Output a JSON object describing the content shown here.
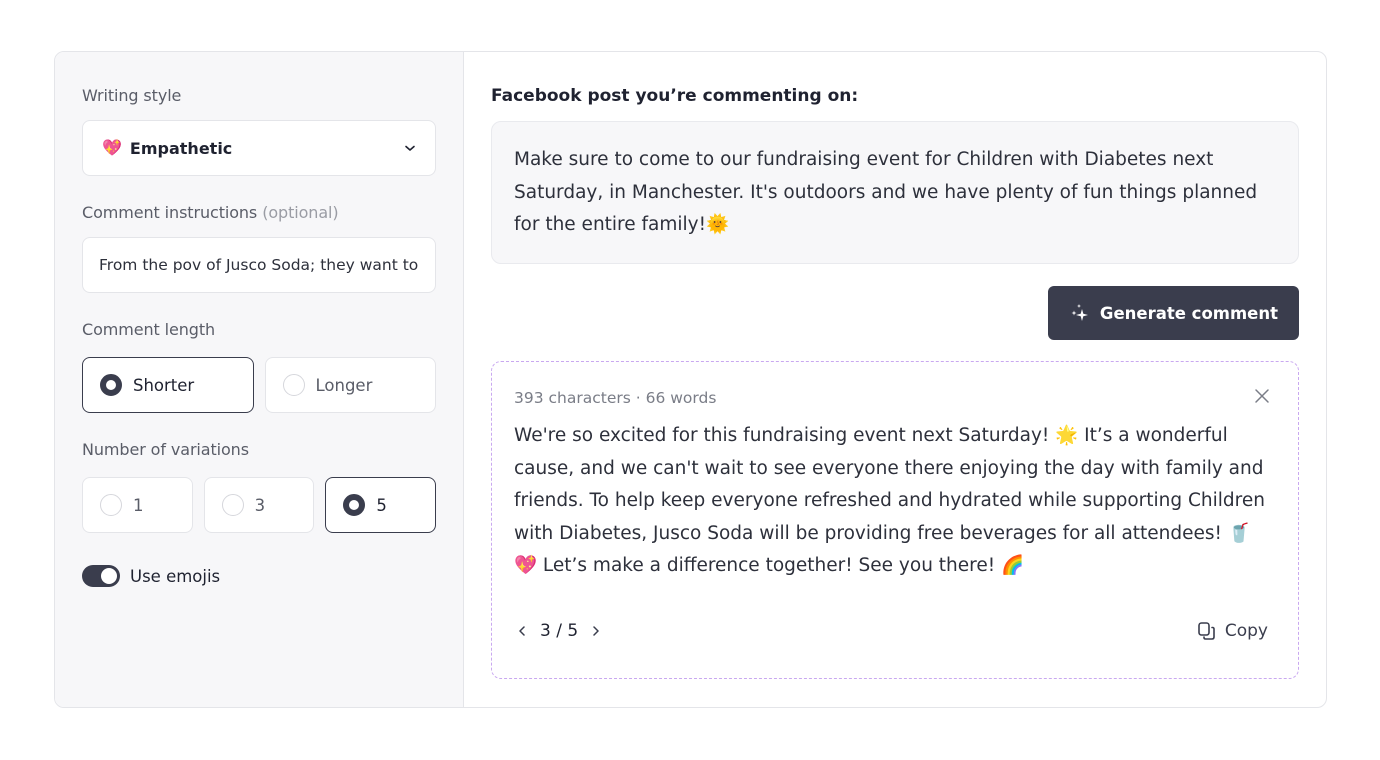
{
  "sidebar": {
    "writing_style": {
      "label": "Writing style",
      "emoji": "💖",
      "value": "Empathetic"
    },
    "instructions": {
      "label": "Comment instructions",
      "label_optional": "(optional)",
      "value": "From the pov of Jusco Soda; they want to provide free beverages"
    },
    "comment_length": {
      "label": "Comment length",
      "options": [
        {
          "label": "Shorter",
          "selected": true
        },
        {
          "label": "Longer",
          "selected": false
        }
      ]
    },
    "variations": {
      "label": "Number of variations",
      "options": [
        {
          "label": "1",
          "selected": false
        },
        {
          "label": "3",
          "selected": false
        },
        {
          "label": "5",
          "selected": true
        }
      ]
    },
    "use_emojis": {
      "label": "Use emojis",
      "on": true
    }
  },
  "main": {
    "post_title": "Facebook post you’re commenting on:",
    "post_text": "Make sure to come to our fundraising event for Children with Diabetes next Saturday, in Manchester. It's outdoors and we have plenty of fun things planned for the entire family!🌞",
    "generate_label": "Generate comment",
    "result": {
      "meta": "393 characters · 66 words",
      "text": "We're so excited for this fundraising event next Saturday! 🌟 It’s a wonderful cause, and we can't wait to see everyone there enjoying the day with family and friends. To help keep everyone refreshed and hydrated while supporting Children with Diabetes, Jusco Soda will be providing free beverages for all attendees! 🥤 💖 Let’s make a difference together! See you there! 🌈",
      "page_current": 3,
      "page_total": 5,
      "page_display": "3 / 5",
      "copy_label": "Copy"
    }
  },
  "colors": {
    "accent_dark": "#3a3d4d",
    "result_border": "#c9a8f0",
    "sidebar_bg": "#f7f7f9"
  }
}
